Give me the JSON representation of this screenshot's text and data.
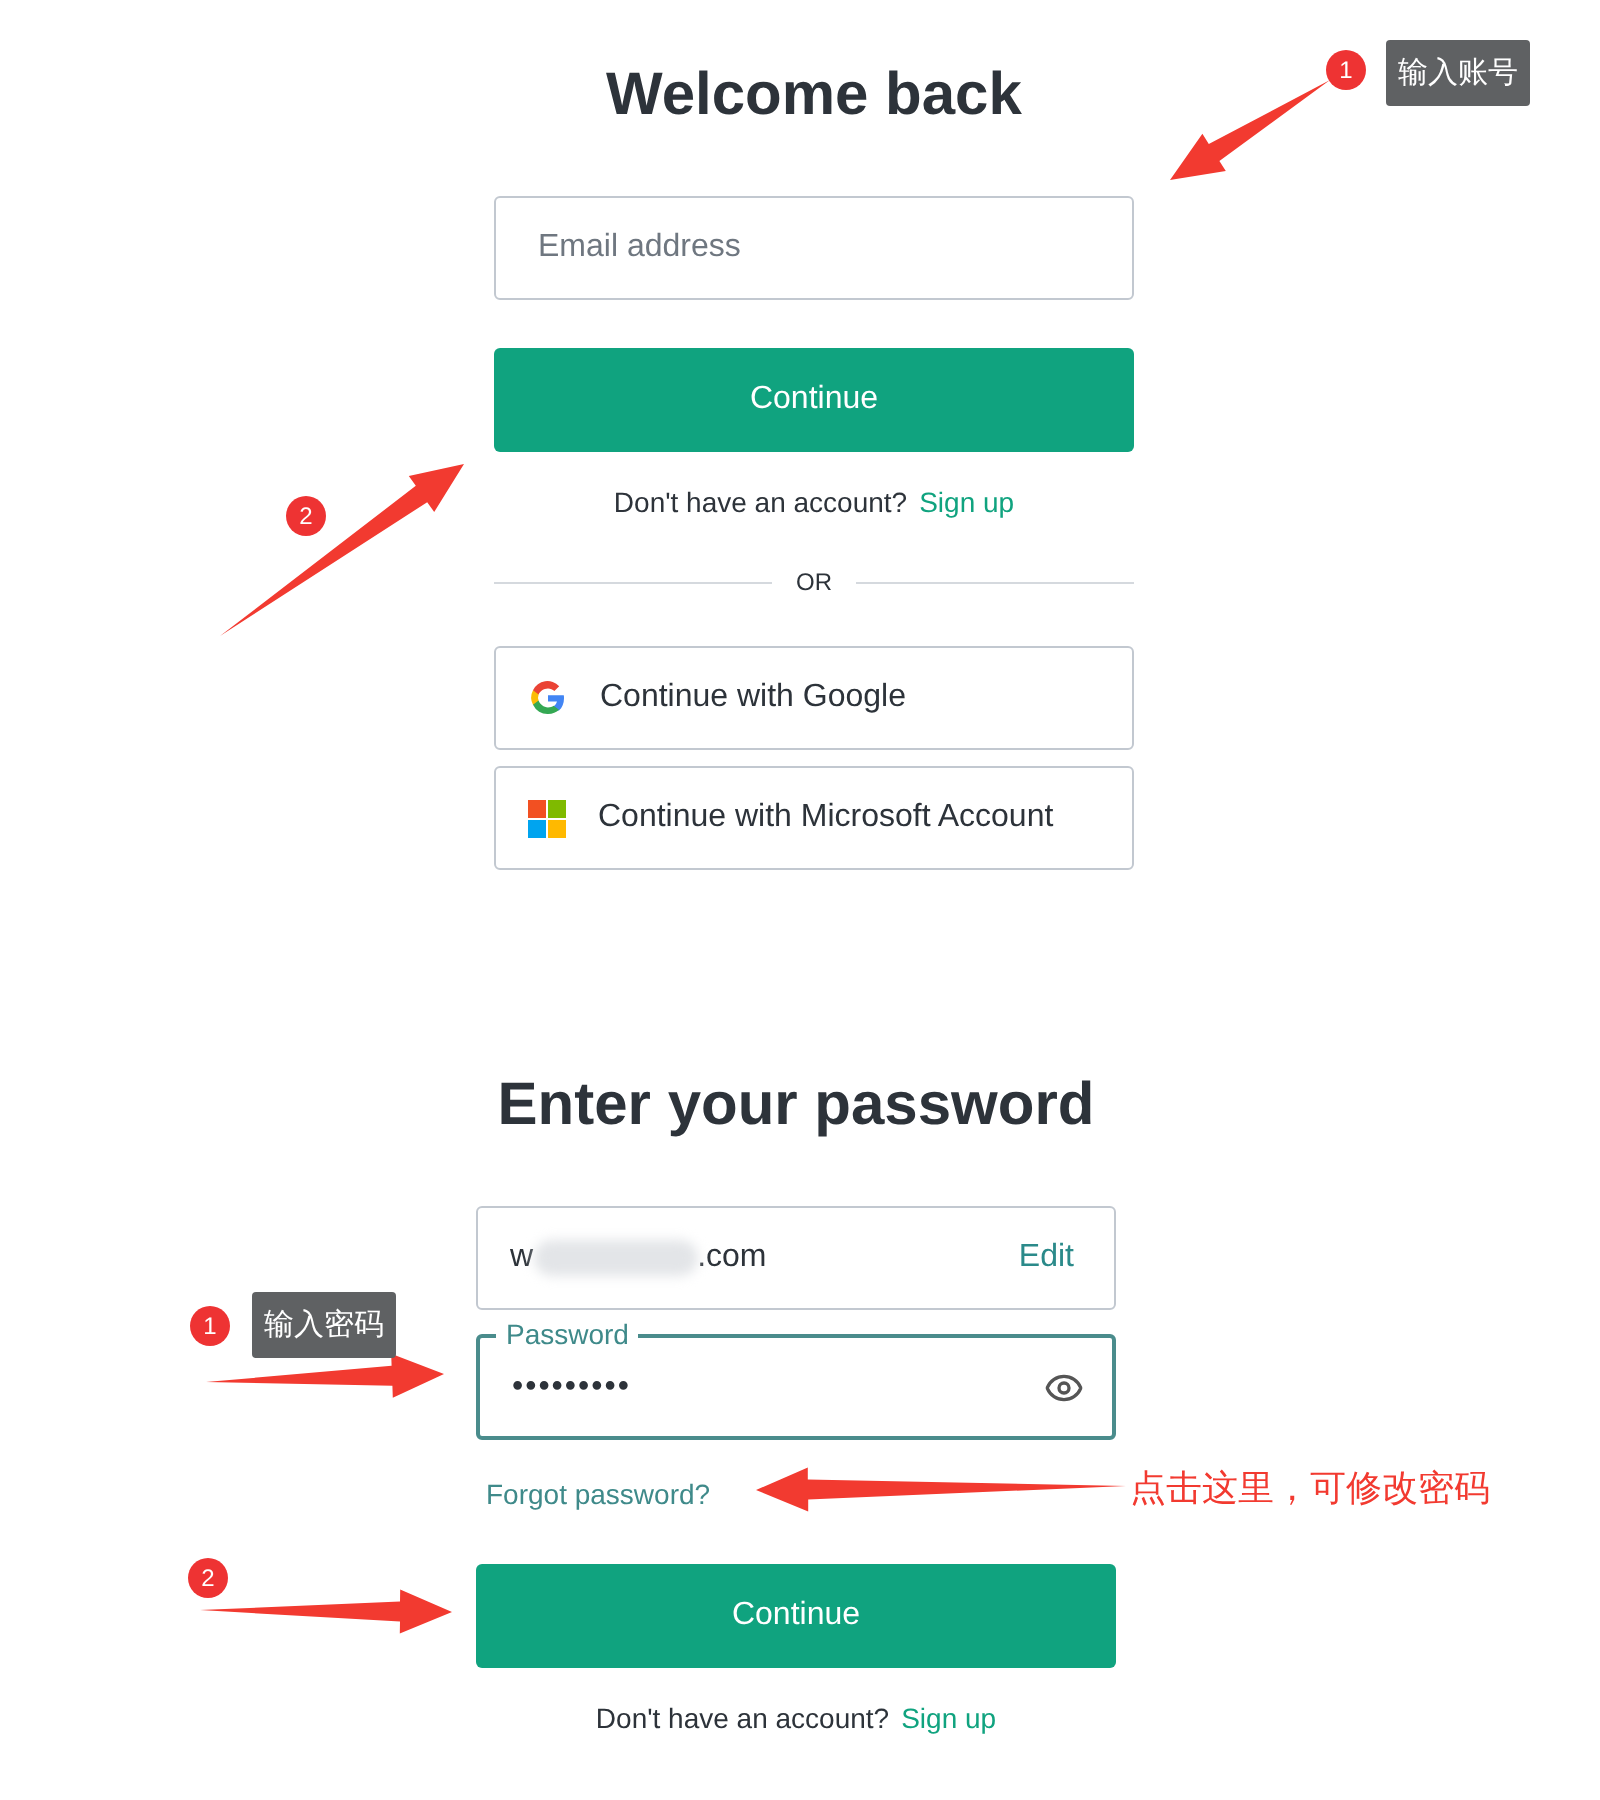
{
  "login": {
    "title": "Welcome back",
    "email_field": {
      "placeholder": "Email address"
    },
    "continue_button": "Continue",
    "signup_prompt": {
      "text": "Don't have an account?",
      "link": "Sign up"
    },
    "divider": "OR",
    "social_buttons": [
      {
        "kind": "google",
        "label": "Continue with Google"
      },
      {
        "kind": "microsoft",
        "label": "Continue with Microsoft Account"
      }
    ]
  },
  "password_step": {
    "title": "Enter your password",
    "email": {
      "value_start": "w",
      "value_end": ".com",
      "redacted": true,
      "action": "Edit"
    },
    "password_field": {
      "label": "Password",
      "value": "•••••••••",
      "focused": true
    },
    "forgot_link": "Forgot password?",
    "continue_button": "Continue",
    "signup_prompt": {
      "text": "Don't have an account?",
      "link": "Sign up"
    }
  },
  "annotations": {
    "badges": [
      {
        "text": "1"
      },
      {
        "text": "2"
      },
      {
        "text": "1"
      },
      {
        "text": "2"
      }
    ],
    "callouts": [
      {
        "text": "输入账号"
      },
      {
        "text": "输入密码"
      }
    ],
    "note": "点击这里，可修改密码"
  }
}
